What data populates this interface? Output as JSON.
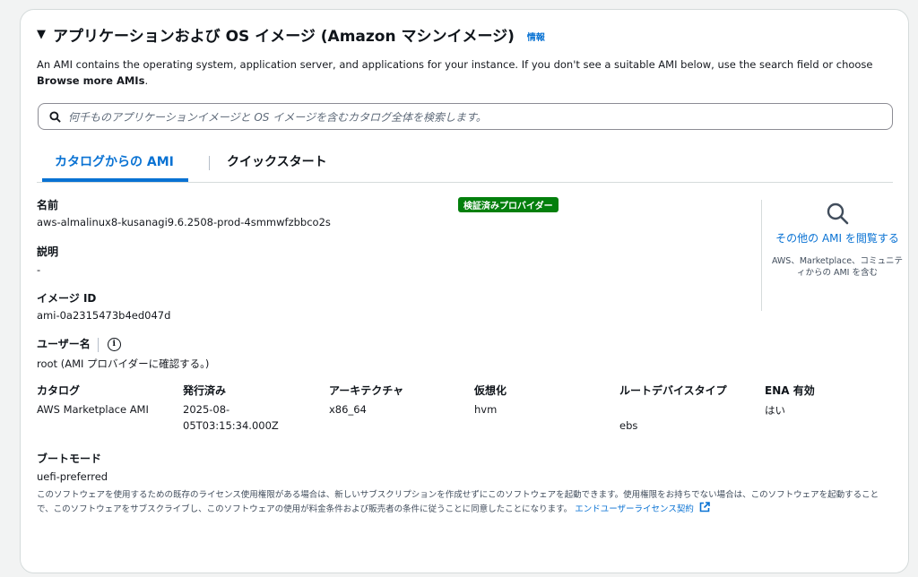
{
  "section": {
    "title": "アプリケーションおよび OS イメージ (Amazon マシンイメージ)",
    "info_link": "情報",
    "description_prefix": "An AMI contains the operating system, application server, and applications for your instance. If you don't see a suitable AMI below, use the search field or choose ",
    "description_bold": "Browse more AMIs",
    "description_suffix": "."
  },
  "search": {
    "placeholder": "何千ものアプリケーションイメージと OS イメージを含むカタログ全体を検索します。"
  },
  "tabs": [
    {
      "label": "カタログからの AMI",
      "active": true
    },
    {
      "label": "クイックスタート",
      "active": false
    }
  ],
  "ami": {
    "name_label": "名前",
    "name_value": "aws-almalinux8-kusanagi9.6.2508-prod-4smmwfzbbco2s",
    "verified_badge": "検証済みプロバイダー",
    "desc_label": "説明",
    "desc_value": "-",
    "id_label": "イメージ ID",
    "id_value": "ami-0a2315473b4ed047d",
    "user_label": "ユーザー名",
    "user_value": "root (AMI プロバイダーに確認する。)"
  },
  "sidebar": {
    "link_text": "その他の AMI を閲覧する",
    "sub_text": "AWS、Marketplace、コミュニティからの AMI を含む"
  },
  "details": {
    "catalog_label": "カタログ",
    "catalog_value": "AWS Marketplace AMI",
    "published_label": "発行済み",
    "published_value_1": "2025-08-",
    "published_value_2": "05T03:15:34.000Z",
    "arch_label": "アーキテクチャ",
    "arch_value": "x86_64",
    "virt_label": "仮想化",
    "virt_value": "hvm",
    "root_label": "ルートデバイスタイプ",
    "root_value": "ebs",
    "ena_label": "ENA 有効",
    "ena_value": "はい"
  },
  "boot": {
    "label": "ブートモード",
    "value": "uefi-preferred"
  },
  "legal": {
    "text": "このソフトウェアを使用するための既存のライセンス使用権限がある場合は、新しいサブスクリプションを作成せずにこのソフトウェアを起動できます。使用権限をお持ちでない場合は、このソフトウェアを起動することで、このソフトウェアをサブスクライブし、このソフトウェアの使用が料金条件および販売者の条件に従うことに同意したことになります。",
    "link": "エンドユーザーライセンス契約"
  },
  "colors": {
    "link": "#0972d3",
    "badge": "#037f0c",
    "border": "#d5dbdb"
  }
}
